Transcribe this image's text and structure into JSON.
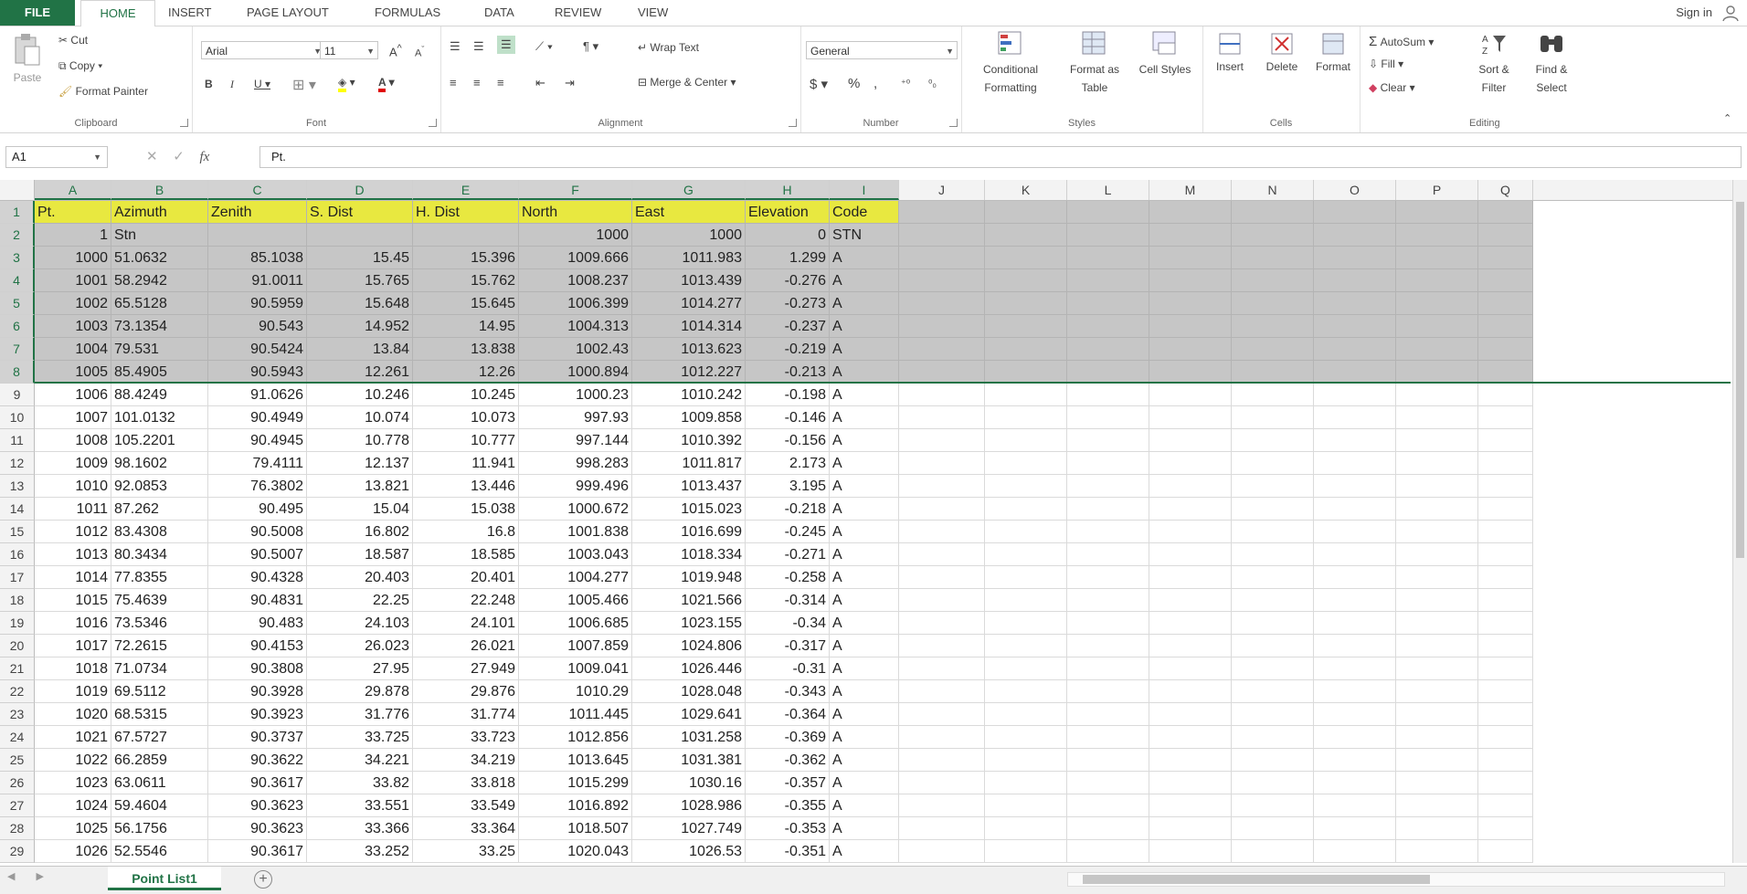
{
  "ribbon": {
    "tabs": [
      "FILE",
      "HOME",
      "INSERT",
      "PAGE LAYOUT",
      "FORMULAS",
      "DATA",
      "REVIEW",
      "VIEW"
    ],
    "active_tab": "HOME",
    "sign_in": "Sign in",
    "clipboard": {
      "paste": "Paste",
      "cut": "Cut",
      "copy": "Copy",
      "format_painter": "Format Painter",
      "label": "Clipboard"
    },
    "font": {
      "name": "Arial",
      "size": "11",
      "label": "Font"
    },
    "alignment": {
      "wrap_text": "Wrap Text",
      "merge_center": "Merge & Center",
      "label": "Alignment"
    },
    "number": {
      "format": "General",
      "label": "Number"
    },
    "styles": {
      "conditional": "Conditional Formatting",
      "format_table": "Format as Table",
      "cell_styles": "Cell Styles",
      "label": "Styles"
    },
    "cells": {
      "insert": "Insert",
      "delete": "Delete",
      "format": "Format",
      "label": "Cells"
    },
    "editing": {
      "autosum": "AutoSum",
      "fill": "Fill",
      "clear": "Clear",
      "sort_filter": "Sort & Filter",
      "find_select": "Find & Select",
      "label": "Editing"
    }
  },
  "formula_bar": {
    "name_box": "A1",
    "formula": "Pt."
  },
  "columns": [
    "A",
    "B",
    "C",
    "D",
    "E",
    "F",
    "G",
    "H",
    "I",
    "J",
    "K",
    "L",
    "M",
    "N",
    "O",
    "P",
    "Q"
  ],
  "rows": [
    [
      "Pt.",
      "Azimuth",
      "Zenith",
      "S. Dist",
      "H. Dist",
      "North",
      "East",
      "Elevation",
      "Code"
    ],
    [
      "1",
      "Stn",
      "",
      "",
      "",
      "1000",
      "1000",
      "0",
      "STN"
    ],
    [
      "1000",
      "51.0632",
      "85.1038",
      "15.45",
      "15.396",
      "1009.666",
      "1011.983",
      "1.299",
      "A"
    ],
    [
      "1001",
      "58.2942",
      "91.0011",
      "15.765",
      "15.762",
      "1008.237",
      "1013.439",
      "-0.276",
      "A"
    ],
    [
      "1002",
      "65.5128",
      "90.5959",
      "15.648",
      "15.645",
      "1006.399",
      "1014.277",
      "-0.273",
      "A"
    ],
    [
      "1003",
      "73.1354",
      "90.543",
      "14.952",
      "14.95",
      "1004.313",
      "1014.314",
      "-0.237",
      "A"
    ],
    [
      "1004",
      "79.531",
      "90.5424",
      "13.84",
      "13.838",
      "1002.43",
      "1013.623",
      "-0.219",
      "A"
    ],
    [
      "1005",
      "85.4905",
      "90.5943",
      "12.261",
      "12.26",
      "1000.894",
      "1012.227",
      "-0.213",
      "A"
    ],
    [
      "1006",
      "88.4249",
      "91.0626",
      "10.246",
      "10.245",
      "1000.23",
      "1010.242",
      "-0.198",
      "A"
    ],
    [
      "1007",
      "101.0132",
      "90.4949",
      "10.074",
      "10.073",
      "997.93",
      "1009.858",
      "-0.146",
      "A"
    ],
    [
      "1008",
      "105.2201",
      "90.4945",
      "10.778",
      "10.777",
      "997.144",
      "1010.392",
      "-0.156",
      "A"
    ],
    [
      "1009",
      "98.1602",
      "79.4111",
      "12.137",
      "11.941",
      "998.283",
      "1011.817",
      "2.173",
      "A"
    ],
    [
      "1010",
      "92.0853",
      "76.3802",
      "13.821",
      "13.446",
      "999.496",
      "1013.437",
      "3.195",
      "A"
    ],
    [
      "1011",
      "87.262",
      "90.495",
      "15.04",
      "15.038",
      "1000.672",
      "1015.023",
      "-0.218",
      "A"
    ],
    [
      "1012",
      "83.4308",
      "90.5008",
      "16.802",
      "16.8",
      "1001.838",
      "1016.699",
      "-0.245",
      "A"
    ],
    [
      "1013",
      "80.3434",
      "90.5007",
      "18.587",
      "18.585",
      "1003.043",
      "1018.334",
      "-0.271",
      "A"
    ],
    [
      "1014",
      "77.8355",
      "90.4328",
      "20.403",
      "20.401",
      "1004.277",
      "1019.948",
      "-0.258",
      "A"
    ],
    [
      "1015",
      "75.4639",
      "90.4831",
      "22.25",
      "22.248",
      "1005.466",
      "1021.566",
      "-0.314",
      "A"
    ],
    [
      "1016",
      "73.5346",
      "90.483",
      "24.103",
      "24.101",
      "1006.685",
      "1023.155",
      "-0.34",
      "A"
    ],
    [
      "1017",
      "72.2615",
      "90.4153",
      "26.023",
      "26.021",
      "1007.859",
      "1024.806",
      "-0.317",
      "A"
    ],
    [
      "1018",
      "71.0734",
      "90.3808",
      "27.95",
      "27.949",
      "1009.041",
      "1026.446",
      "-0.31",
      "A"
    ],
    [
      "1019",
      "69.5112",
      "90.3928",
      "29.878",
      "29.876",
      "1010.29",
      "1028.048",
      "-0.343",
      "A"
    ],
    [
      "1020",
      "68.5315",
      "90.3923",
      "31.776",
      "31.774",
      "1011.445",
      "1029.641",
      "-0.364",
      "A"
    ],
    [
      "1021",
      "67.5727",
      "90.3737",
      "33.725",
      "33.723",
      "1012.856",
      "1031.258",
      "-0.369",
      "A"
    ],
    [
      "1022",
      "66.2859",
      "90.3622",
      "34.221",
      "34.219",
      "1013.645",
      "1031.381",
      "-0.362",
      "A"
    ],
    [
      "1023",
      "63.0611",
      "90.3617",
      "33.82",
      "33.818",
      "1015.299",
      "1030.16",
      "-0.357",
      "A"
    ],
    [
      "1024",
      "59.4604",
      "90.3623",
      "33.551",
      "33.549",
      "1016.892",
      "1028.986",
      "-0.355",
      "A"
    ],
    [
      "1025",
      "56.1756",
      "90.3623",
      "33.366",
      "33.364",
      "1018.507",
      "1027.749",
      "-0.353",
      "A"
    ],
    [
      "1026",
      "52.5546",
      "90.3617",
      "33.252",
      "33.25",
      "1020.043",
      "1026.53",
      "-0.351",
      "A"
    ]
  ],
  "sheet": {
    "tab": "Point List1",
    "add": "+"
  }
}
